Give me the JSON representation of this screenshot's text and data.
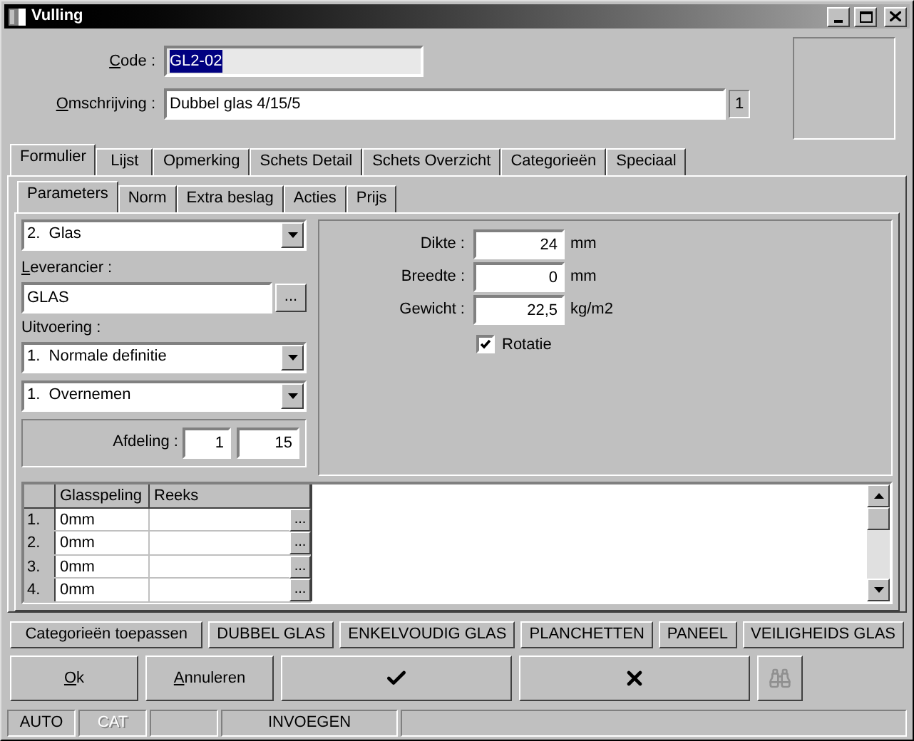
{
  "window": {
    "title": "Vulling"
  },
  "header": {
    "code": {
      "label": "Code :",
      "accelerator": true,
      "value": "GL2-02",
      "selected": true
    },
    "description": {
      "label": "Omschrijving :",
      "accelerator": true,
      "value": "Dubbel glas 4/15/5",
      "badge": "1"
    }
  },
  "tabs": [
    {
      "label": "Formulier",
      "selected": true
    },
    {
      "label": "Lijst",
      "selected": false
    },
    {
      "label": "Opmerking",
      "selected": false
    },
    {
      "label": "Schets Detail",
      "selected": false
    },
    {
      "label": "Schets Overzicht",
      "selected": false
    },
    {
      "label": "Categorieën",
      "selected": false
    },
    {
      "label": "Speciaal",
      "selected": false
    }
  ],
  "subtabs": [
    {
      "label": "Parameters",
      "selected": true
    },
    {
      "label": "Norm",
      "selected": false
    },
    {
      "label": "Extra beslag",
      "selected": false
    },
    {
      "label": "Acties",
      "selected": false
    },
    {
      "label": "Prijs",
      "selected": false
    }
  ],
  "parameters": {
    "type_select": "2.  Glas",
    "supplier": {
      "label": "Leverancier :",
      "accelerator": true,
      "value": "GLAS",
      "button": "..."
    },
    "execution": {
      "label": "Uitvoering :",
      "accelerator": false,
      "select": "1.  Normale definitie"
    },
    "mode_select": "1.  Overnemen",
    "department": {
      "label": "Afdeling :",
      "values": [
        "1",
        "15"
      ]
    }
  },
  "measurements": [
    {
      "label": "Dikte :",
      "value": "24",
      "unit": "mm"
    },
    {
      "label": "Breedte :",
      "value": "0",
      "unit": "mm"
    },
    {
      "label": "Gewicht :",
      "value": "22,5",
      "unit": "kg/m2"
    }
  ],
  "rotation": {
    "label": "Rotatie",
    "checked": true
  },
  "grid": {
    "columns": [
      "Glasspeling",
      "Reeks"
    ],
    "rows": [
      {
        "number": "1.",
        "glasspeling": "0mm",
        "button": "..."
      },
      {
        "number": "2.",
        "glasspeling": "0mm",
        "button": "..."
      },
      {
        "number": "3.",
        "glasspeling": "0mm",
        "button": "..."
      },
      {
        "number": "4.",
        "glasspeling": "0mm",
        "button": "..."
      }
    ]
  },
  "categories": {
    "apply_button": "Categorieën toepassen",
    "items": [
      "DUBBEL GLAS",
      "ENKELVOUDIG GLAS",
      "PLANCHETTEN",
      "PANEEL",
      "VEILIGHEIDS GLAS"
    ]
  },
  "actions": [
    {
      "kind": "text",
      "label": "Ok",
      "accelerator": true,
      "disabled": false
    },
    {
      "kind": "text",
      "label": "Annuleren",
      "accelerator": true,
      "disabled": false
    },
    {
      "kind": "check",
      "disabled": false
    },
    {
      "kind": "cross",
      "disabled": false
    },
    {
      "kind": "binoculars",
      "disabled": true
    }
  ],
  "status_bar": [
    {
      "kind": "text",
      "text": "AUTO",
      "disabled": false
    },
    {
      "kind": "text",
      "text": "CAT",
      "disabled": true
    },
    {
      "kind": "empty"
    },
    {
      "kind": "text",
      "text": "INVOEGEN",
      "disabled": false
    },
    {
      "kind": "empty"
    }
  ]
}
